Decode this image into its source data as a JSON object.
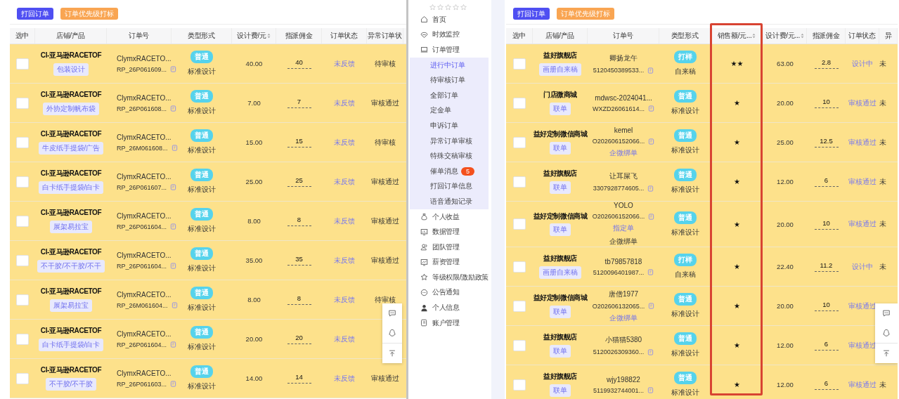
{
  "left_panel": {
    "buttons": [
      {
        "label": "打回订单",
        "kind": "primary"
      },
      {
        "label": "订单优先级打标",
        "kind": "warning"
      }
    ],
    "table": {
      "columns": [
        {
          "label": "选中",
          "sortable": false
        },
        {
          "label": "店铺/产品",
          "sortable": false
        },
        {
          "label": "订单号",
          "sortable": false
        },
        {
          "label": "类型形式",
          "sortable": false
        },
        {
          "label": "设计费/元",
          "sortable": true
        },
        {
          "label": "指派佣金",
          "sortable": false
        },
        {
          "label": "订单状态",
          "sortable": false
        },
        {
          "label": "异常订单状",
          "sortable": false
        }
      ],
      "rows": [
        {
          "checked": false,
          "shop": "CI-亚马逊RACETOF",
          "product": "包装设计",
          "order_lines": [
            {
              "text": "ClymxRACETO...",
              "kind": "plain"
            },
            {
              "text": "RP_26P061609...",
              "kind": "number"
            }
          ],
          "type_tag": "普通",
          "type_label": "标准设计",
          "design_fee": "40.00",
          "commission": "40",
          "status": "未反馈",
          "abnormal_status": "待审核"
        },
        {
          "checked": false,
          "shop": "CI-亚马逊RACETOF",
          "product": "外协定制帆布袋",
          "order_lines": [
            {
              "text": "ClymxRACETO...",
              "kind": "plain"
            },
            {
              "text": "RP_26P061608...",
              "kind": "number"
            }
          ],
          "type_tag": "普通",
          "type_label": "标准设计",
          "design_fee": "7.00",
          "commission": "7",
          "status": "未反馈",
          "abnormal_status": "审核通过"
        },
        {
          "checked": false,
          "shop": "CI-亚马逊RACETOF",
          "product": "牛皮纸手提袋/广告",
          "order_lines": [
            {
              "text": "ClymxRACETO...",
              "kind": "plain"
            },
            {
              "text": "RP_26M061608...",
              "kind": "number"
            }
          ],
          "type_tag": "普通",
          "type_label": "标准设计",
          "design_fee": "15.00",
          "commission": "15",
          "status": "未反馈",
          "abnormal_status": "待审核"
        },
        {
          "checked": false,
          "shop": "CI-亚马逊RACETOF",
          "product": "白卡纸手提袋/白卡",
          "order_lines": [
            {
              "text": "ClymxRACETO...",
              "kind": "plain"
            },
            {
              "text": "RP_26P061607...",
              "kind": "number"
            }
          ],
          "type_tag": "普通",
          "type_label": "标准设计",
          "design_fee": "25.00",
          "commission": "25",
          "status": "未反馈",
          "abnormal_status": "审核通过"
        },
        {
          "checked": false,
          "shop": "CI-亚马逊RACETOF",
          "product": "展架易拉宝",
          "order_lines": [
            {
              "text": "ClymxRACETO...",
              "kind": "plain"
            },
            {
              "text": "RP_26P061604...",
              "kind": "number"
            }
          ],
          "type_tag": "普通",
          "type_label": "标准设计",
          "design_fee": "8.00",
          "commission": "8",
          "status": "未反馈",
          "abnormal_status": "审核通过"
        },
        {
          "checked": false,
          "shop": "CI-亚马逊RACETOF",
          "product": "不干胶/不干胶/不干",
          "order_lines": [
            {
              "text": "ClymxRACETO...",
              "kind": "plain"
            },
            {
              "text": "RP_26P061604...",
              "kind": "number"
            }
          ],
          "type_tag": "普通",
          "type_label": "标准设计",
          "design_fee": "35.00",
          "commission": "35",
          "status": "未反馈",
          "abnormal_status": "审核通过"
        },
        {
          "checked": false,
          "shop": "CI-亚马逊RACETOF",
          "product": "展架易拉宝",
          "order_lines": [
            {
              "text": "ClymxRACETO...",
              "kind": "plain"
            },
            {
              "text": "RP_26M061604...",
              "kind": "number"
            }
          ],
          "type_tag": "普通",
          "type_label": "标准设计",
          "design_fee": "8.00",
          "commission": "8",
          "status": "未反馈",
          "abnormal_status": "待审核"
        },
        {
          "checked": false,
          "shop": "CI-亚马逊RACETOF",
          "product": "白卡纸手提袋/白卡",
          "order_lines": [
            {
              "text": "ClymxRACETO...",
              "kind": "plain"
            },
            {
              "text": "RP_26P061604...",
              "kind": "number"
            }
          ],
          "type_tag": "普通",
          "type_label": "标准设计",
          "design_fee": "20.00",
          "commission": "20",
          "status": "未反馈"
        },
        {
          "checked": false,
          "shop": "CI-亚马逊RACETOF",
          "product": "不干胶/不干胶",
          "order_lines": [
            {
              "text": "ClymxRACETO...",
              "kind": "plain"
            },
            {
              "text": "RP_26P061603...",
              "kind": "number"
            }
          ],
          "type_tag": "普通",
          "type_label": "标准设计",
          "design_fee": "14.00",
          "commission": "14",
          "status": "未反馈",
          "abnormal_status": "审核通过"
        }
      ]
    }
  },
  "sidebar": {
    "stars": 0,
    "items": [
      {
        "label": "首页"
      },
      {
        "label": "时效监控"
      },
      {
        "label": "订单管理",
        "children": [
          {
            "label": "进行中订单",
            "selected": true
          },
          {
            "label": "待审核订单",
            "selected": false
          },
          {
            "label": "全部订单",
            "selected": false
          },
          {
            "label": "定金单",
            "selected": false
          },
          {
            "label": "申诉订单",
            "selected": false
          },
          {
            "label": "异常订单审核",
            "selected": false
          },
          {
            "label": "特殊交稿审核",
            "selected": false
          },
          {
            "label": "催单消息",
            "selected": false,
            "badge": "5"
          },
          {
            "label": "打回订单信息",
            "selected": false
          },
          {
            "label": "语音通知记录",
            "selected": false
          }
        ]
      },
      {
        "label": "个人收益"
      },
      {
        "label": "数据管理"
      },
      {
        "label": "团队管理"
      },
      {
        "label": "薪资管理"
      },
      {
        "label": "等级权限/激励政策"
      },
      {
        "label": "公告通知"
      },
      {
        "label": "个人信息"
      },
      {
        "label": "账户管理"
      }
    ]
  },
  "right_panel": {
    "buttons": [
      {
        "label": "打回订单",
        "kind": "primary"
      },
      {
        "label": "订单优先级打标",
        "kind": "warning"
      }
    ],
    "table": {
      "columns": [
        {
          "label": "选中",
          "sortable": false
        },
        {
          "label": "店铺/产品",
          "sortable": false
        },
        {
          "label": "订单号",
          "sortable": false
        },
        {
          "label": "类型形式",
          "sortable": false
        },
        {
          "label": "销售额/元...",
          "sortable": true
        },
        {
          "label": "设计费/元...",
          "sortable": true
        },
        {
          "label": "指派佣金",
          "sortable": false
        },
        {
          "label": "订单状态",
          "sortable": false
        },
        {
          "label": "异",
          "sortable": false
        }
      ],
      "rows": [
        {
          "checked": false,
          "shop": "益好旗舰店",
          "product": "画册自来稿",
          "order_lines": [
            {
              "text": "卿扬龙午",
              "kind": "plain"
            },
            {
              "text": "5120450389533...",
              "kind": "number"
            }
          ],
          "type_tag": "打样",
          "type_label": "自来稿",
          "sales_rating": "★★",
          "design_fee": "63.00",
          "commission": "2.8",
          "status": "设计中",
          "column_9": "未"
        },
        {
          "checked": false,
          "shop": "门店微商城",
          "product": "联单",
          "order_lines": [
            {
              "text": "mdwsc-2024041...",
              "kind": "plain"
            },
            {
              "text": "WXZD26061614...",
              "kind": "number"
            }
          ],
          "type_tag": "普通",
          "type_label": "标准设计",
          "sales_rating": "★",
          "design_fee": "20.00",
          "commission": "10",
          "status": "审核通过",
          "column_9": "未"
        },
        {
          "checked": false,
          "shop": "益好定制微信商城",
          "product": "联单",
          "order_lines": [
            {
              "text": "kemel",
              "kind": "plain"
            },
            {
              "text": "O202606152066...",
              "kind": "number"
            },
            {
              "text": "企微绑单",
              "kind": "link"
            }
          ],
          "type_tag": "普通",
          "type_label": "标准设计",
          "sales_rating": "★",
          "design_fee": "25.00",
          "commission": "12.5",
          "status": "审核通过",
          "column_9": "未"
        },
        {
          "checked": false,
          "shop": "益好旗舰店",
          "product": "联单",
          "order_lines": [
            {
              "text": "让耳屎飞",
              "kind": "plain"
            },
            {
              "text": "3307928774605...",
              "kind": "number"
            }
          ],
          "type_tag": "普通",
          "type_label": "标准设计",
          "sales_rating": "★",
          "design_fee": "12.00",
          "commission": "6",
          "status": "审核通过",
          "column_9": "未"
        },
        {
          "checked": false,
          "shop": "益好定制微信商城",
          "product": "联单",
          "order_lines": [
            {
              "text": "YOLO",
              "kind": "plain"
            },
            {
              "text": "O202606152066...",
              "kind": "number"
            },
            {
              "text": "指定单",
              "kind": "link"
            },
            {
              "text": "企微绑单",
              "kind": "plain"
            }
          ],
          "type_tag": "普通",
          "type_label": "标准设计",
          "sales_rating": "★",
          "design_fee": "20.00",
          "commission": "10",
          "status": "审核通过",
          "column_9": "未"
        },
        {
          "checked": false,
          "shop": "益好旗舰店",
          "product": "画册自来稿",
          "order_lines": [
            {
              "text": "tb79857818",
              "kind": "plain"
            },
            {
              "text": "5120096401987...",
              "kind": "number"
            }
          ],
          "type_tag": "打样",
          "type_label": "自来稿",
          "sales_rating": "★",
          "design_fee": "22.40",
          "commission": "11.2",
          "status": "设计中",
          "column_9": "未"
        },
        {
          "checked": false,
          "shop": "益好定制微信商城",
          "product": "联单",
          "order_lines": [
            {
              "text": "唐僧1977",
              "kind": "plain"
            },
            {
              "text": "O202606132065...",
              "kind": "number"
            },
            {
              "text": "企微绑单",
              "kind": "link"
            }
          ],
          "type_tag": "普通",
          "type_label": "标准设计",
          "sales_rating": "★",
          "design_fee": "20.00",
          "commission": "10",
          "status": "审核通过"
        },
        {
          "checked": false,
          "shop": "益好旗舰店",
          "product": "联单",
          "order_lines": [
            {
              "text": "小猫猫5380",
              "kind": "plain"
            },
            {
              "text": "5120026309360...",
              "kind": "number"
            }
          ],
          "type_tag": "普通",
          "type_label": "标准设计",
          "sales_rating": "★",
          "design_fee": "12.00",
          "commission": "6",
          "status": "审核通过"
        },
        {
          "checked": false,
          "shop": "益好旗舰店",
          "product": "联单",
          "order_lines": [
            {
              "text": "wjy198822",
              "kind": "plain"
            },
            {
              "text": "5119932744001...",
              "kind": "number"
            }
          ],
          "type_tag": "普通",
          "type_label": "标准设计",
          "sales_rating": "★",
          "design_fee": "12.00",
          "commission": "6",
          "status": "审核通过",
          "column_9": "未"
        }
      ]
    }
  }
}
